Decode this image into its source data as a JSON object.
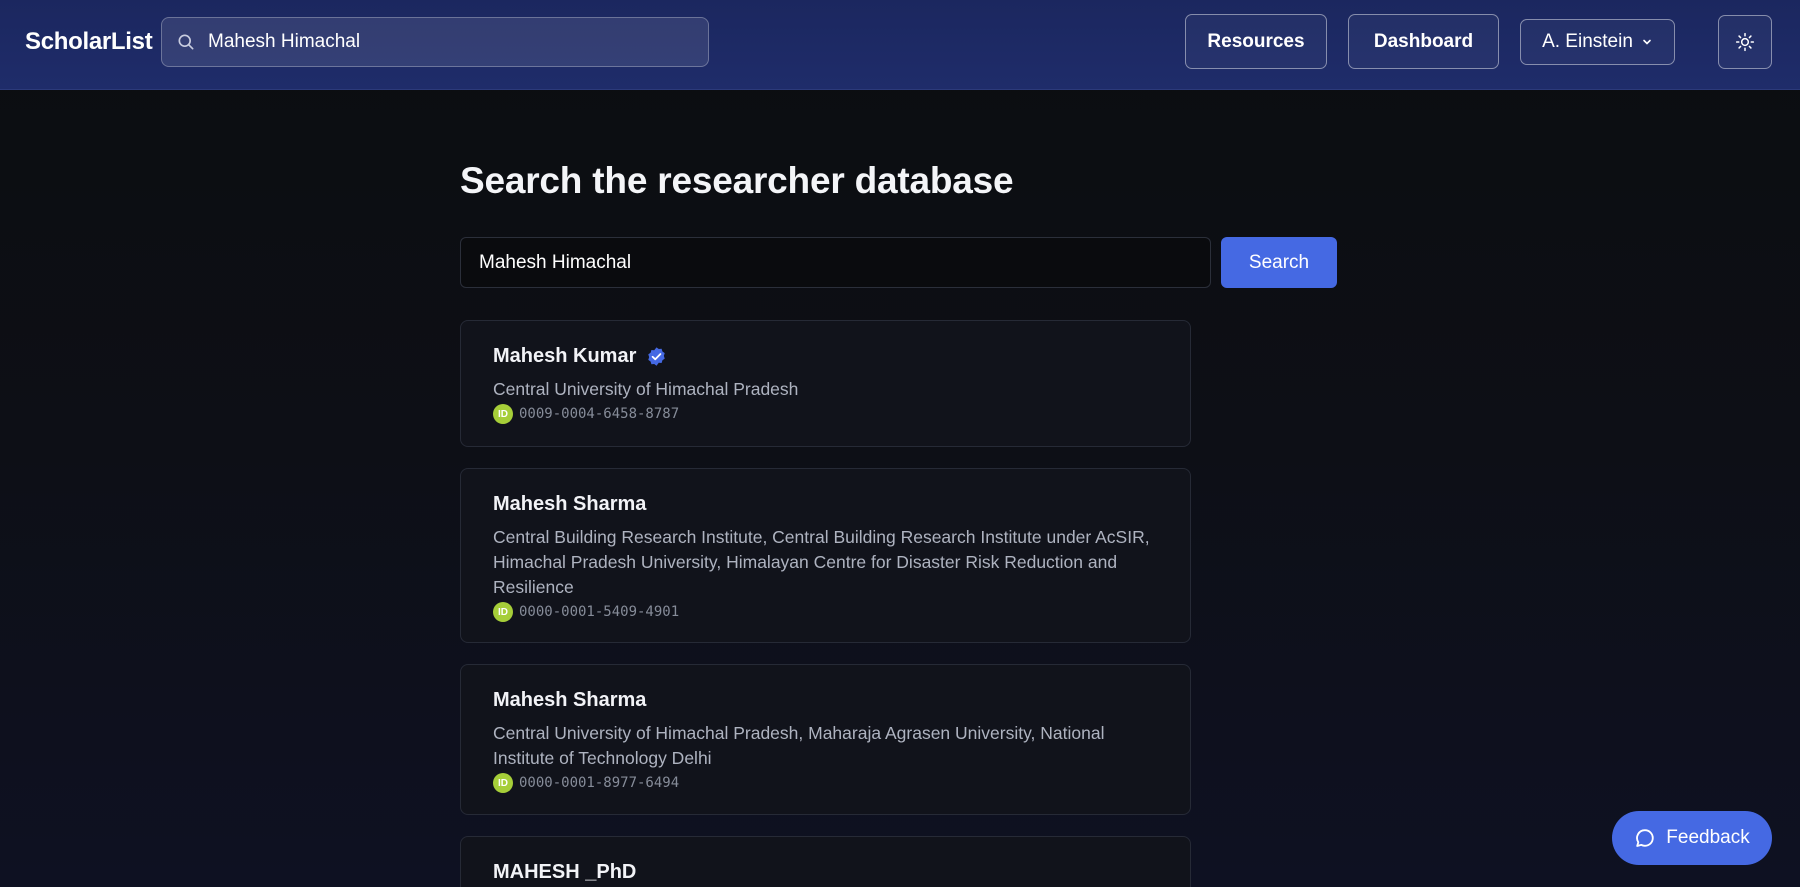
{
  "header": {
    "logo": "ScholarList",
    "search_value": "Mahesh Himachal",
    "resources_label": "Resources",
    "dashboard_label": "Dashboard",
    "user_label": "A. Einstein"
  },
  "main": {
    "title": "Search the researcher database",
    "search_value": "Mahesh Himachal",
    "search_button": "Search"
  },
  "results": [
    {
      "name": "Mahesh Kumar",
      "verified": true,
      "affiliation": "Central University of Himachal Pradesh",
      "orcid": "0009-0004-6458-8787"
    },
    {
      "name": "Mahesh Sharma",
      "verified": false,
      "affiliation": "Central Building Research Institute, Central Building Research Institute under AcSIR, Himachal Pradesh University, Himalayan Centre for Disaster Risk Reduction and Resilience",
      "orcid": "0000-0001-5409-4901"
    },
    {
      "name": "Mahesh Sharma",
      "verified": false,
      "affiliation": "Central University of Himachal Pradesh, Maharaja Agrasen University, National Institute of Technology Delhi",
      "orcid": "0000-0001-8977-6494"
    },
    {
      "name": "MAHESH _PhD",
      "verified": false,
      "affiliation": "",
      "orcid": ""
    }
  ],
  "orcid_badge": "ID",
  "feedback_label": "Feedback",
  "colors": {
    "header_bg": "#1f2c6a",
    "accent": "#4569e3",
    "orcid": "#a6ce39",
    "card_bg": "#11131b"
  },
  "icons": {
    "search": "search-icon",
    "chevron": "chevron-down-icon",
    "theme": "sun-icon",
    "verified": "verified-check-icon",
    "feedback": "chat-bubble-icon"
  }
}
